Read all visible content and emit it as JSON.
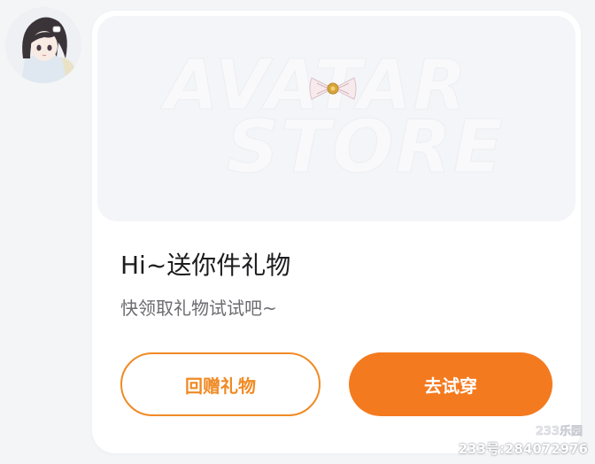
{
  "gift_card": {
    "title": "Hi~送你件礼物",
    "subtitle": "快领取礼物试试吧~",
    "banner": {
      "line1": "AVATAR",
      "line2": "STORE",
      "item_icon": "bow-tie-icon"
    },
    "buttons": {
      "return_gift": "回赠礼物",
      "try_on": "去试穿"
    }
  },
  "sender": {
    "avatar_icon": "anime-girl-avatar"
  },
  "watermark": {
    "logo": "233乐园",
    "id_text": "233号:284072976"
  },
  "colors": {
    "accent": "#f47a1f",
    "accent_border": "#f08a24",
    "card_bg": "#ffffff",
    "page_bg": "#f3f5f7",
    "banner_bg": "#f4f5f8"
  }
}
